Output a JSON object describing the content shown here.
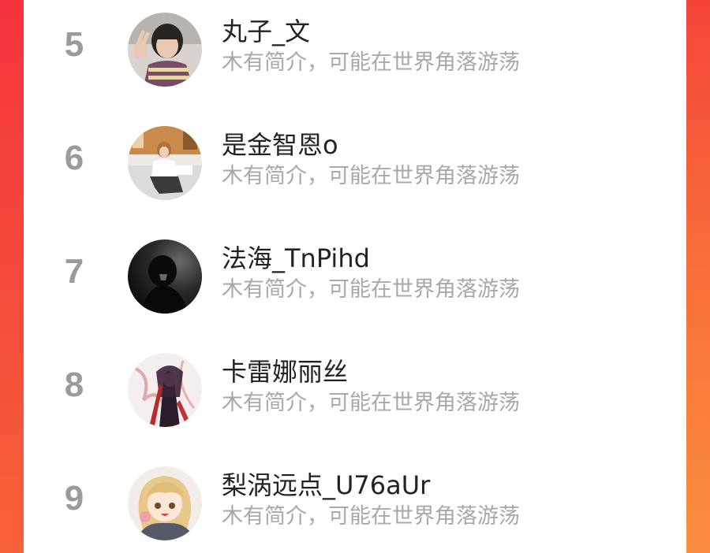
{
  "ranking": {
    "items": [
      {
        "rank": "5",
        "name": "丸子_文",
        "bio": "木有简介，可能在世界角落游荡",
        "avatar_icon": "avatar-photo-girl-peace-sign"
      },
      {
        "rank": "6",
        "name": "是金智恩o",
        "bio": "木有简介，可能在世界角落游荡",
        "avatar_icon": "avatar-photo-room-sitting"
      },
      {
        "rank": "7",
        "name": "法海_TnPihd",
        "bio": "木有简介，可能在世界角落游荡",
        "avatar_icon": "avatar-dark-silhouette"
      },
      {
        "rank": "8",
        "name": "卡雷娜丽丝",
        "bio": "木有简介，可能在世界角落游荡",
        "avatar_icon": "avatar-anime-red-dark"
      },
      {
        "rank": "9",
        "name": "梨涡远点_U76aUr",
        "bio": "木有简介，可能在世界角落游荡",
        "avatar_icon": "avatar-anime-blonde-girl"
      }
    ]
  },
  "colors": {
    "rank_text": "#9b9b9b",
    "name_text": "#222222",
    "bio_text": "#a8a8a8",
    "background_gradient_top": "#f53a3e",
    "background_gradient_bottom": "#fb8a3a"
  }
}
